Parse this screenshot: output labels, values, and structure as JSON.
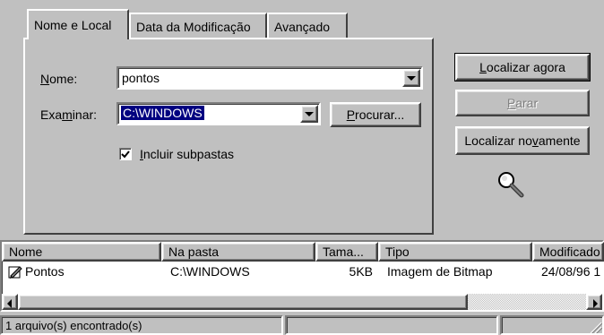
{
  "tabs": [
    {
      "label": "Nome e Local",
      "active": true
    },
    {
      "label": "Data da Modificação",
      "active": false
    },
    {
      "label": "Avançado",
      "active": false
    }
  ],
  "form": {
    "nome_label_u": "N",
    "nome_label_rest": "ome:",
    "nome_value": "pontos",
    "examinar_label_pre": "Exa",
    "examinar_label_u": "m",
    "examinar_label_rest": "inar:",
    "examinar_value": "C:\\WINDOWS",
    "procurar_u": "P",
    "procurar_rest": "rocurar...",
    "incluir_u": "I",
    "incluir_rest": "ncluir subpastas",
    "incluir_checked": true
  },
  "actions": {
    "localizar_u": "L",
    "localizar_rest": "ocalizar agora",
    "parar_u": "P",
    "parar_rest": "arar",
    "novamente_pre": "Localizar no",
    "novamente_u": "v",
    "novamente_rest": "amente"
  },
  "results": {
    "columns": [
      "Nome",
      "Na pasta",
      "Tama...",
      "Tipo",
      "Modificado"
    ],
    "rows": [
      {
        "nome": "Pontos",
        "pasta": "C:\\WINDOWS",
        "tamanho": "5KB",
        "tipo": "Imagem de Bitmap",
        "modificado": "24/08/96 1"
      }
    ]
  },
  "status": {
    "text": "1 arquivo(s) encontrado(s)"
  }
}
